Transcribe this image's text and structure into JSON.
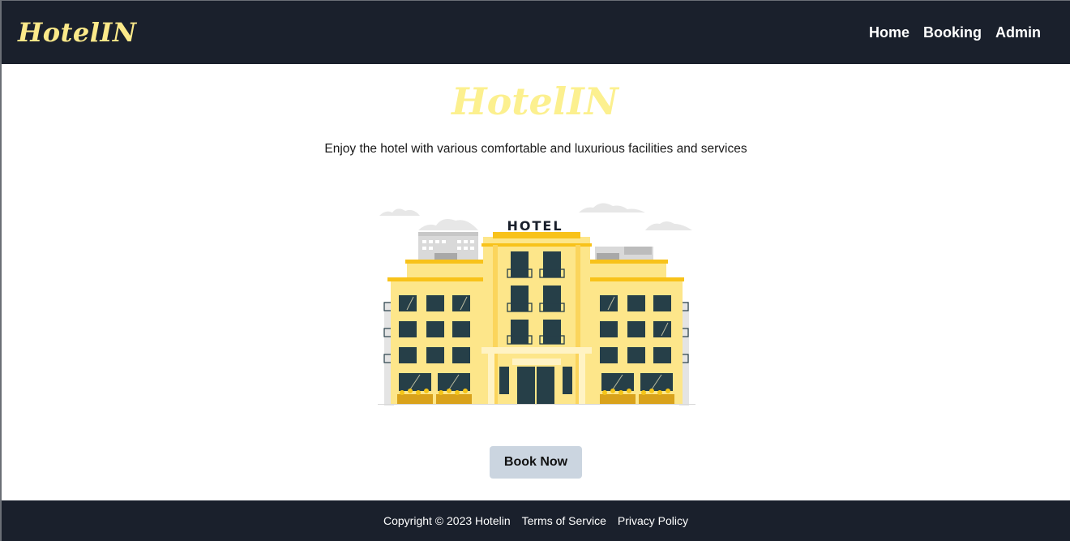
{
  "navbar": {
    "brand": "HotelIN",
    "links": [
      "Home",
      "Booking",
      "Admin"
    ]
  },
  "hero": {
    "title": "HotelIN",
    "subtitle": "Enjoy the hotel with various comfortable and luxurious facilities and services",
    "illustration_sign": "HOTEL",
    "cta_label": "Book Now"
  },
  "footer": {
    "copyright": "Copyright © 2023 Hotelin",
    "links": [
      "Terms of Service",
      "Privacy Policy"
    ]
  },
  "colors": {
    "nav_bg": "#1a202c",
    "brand_yellow": "#fbe98a",
    "button_bg": "#cbd5e0",
    "building_yellow": "#fde68a",
    "building_gold": "#f8c21a",
    "window_dark": "#263f48"
  }
}
